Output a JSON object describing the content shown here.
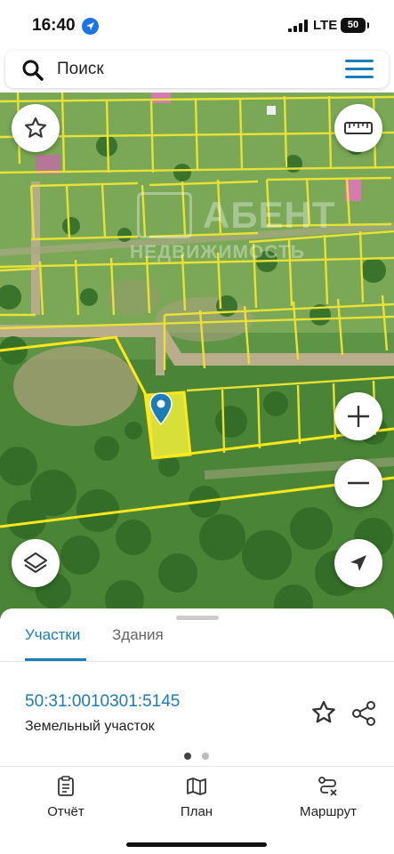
{
  "status_bar": {
    "time": "16:40",
    "network": "LTE",
    "battery": "50"
  },
  "search": {
    "placeholder": "Поиск"
  },
  "map": {
    "watermark_title": "АБЕНТ",
    "watermark_subtitle": "НЕДВИЖИМОСТЬ",
    "parcel_highlight_color": "#f2ee3a",
    "boundary_color": "#ffe81a"
  },
  "sheet": {
    "tabs": [
      {
        "label": "Участки",
        "active": true
      },
      {
        "label": "Здания",
        "active": false
      }
    ],
    "cadastral_number": "50:31:0010301:5145",
    "parcel_type": "Земельный участок",
    "page_count": 2,
    "current_page": 1
  },
  "bottom_nav": {
    "items": [
      {
        "label": "Отчёт",
        "icon": "report-icon"
      },
      {
        "label": "План",
        "icon": "map-plan-icon"
      },
      {
        "label": "Маршрут",
        "icon": "route-icon"
      }
    ]
  },
  "colors": {
    "accent": "#1a7db8",
    "location_arrow": "#1a73e8"
  }
}
